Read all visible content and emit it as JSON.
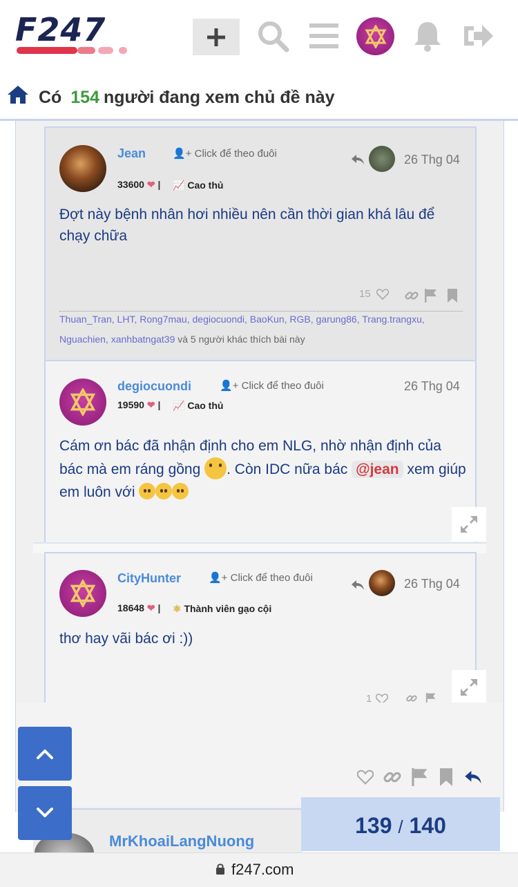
{
  "header": {
    "logo": "F247",
    "icons": [
      "plus-icon",
      "search-icon",
      "menu-icon",
      "user-avatar",
      "bell-icon",
      "logout-icon"
    ]
  },
  "viewers": {
    "prefix": "Có",
    "count": "154",
    "suffix": "người đang xem chủ đề này"
  },
  "posts": [
    {
      "username": "Jean",
      "follow": "Click để theo đuôi",
      "date": "26 Thg 04",
      "points": "33600",
      "rank": "Cao thủ",
      "body": "Đợt này bệnh nhân hơi nhiều nên cần thời gian khá lâu để chạy chữa",
      "likes": "15",
      "likers": [
        "Thuan_Tran",
        "LHT",
        "Rong7mau",
        "degiocuondi",
        "BaoKun",
        "RGB",
        "garung86",
        "Trang.trangxu",
        "Nguachien",
        "xanhbatngat39"
      ],
      "likers_suffix": "và 5 người khác thích bài này"
    },
    {
      "username": "degiocuondi",
      "follow": "Click để theo đuôi",
      "date": "26 Thg 04",
      "points": "19590",
      "rank": "Cao thủ",
      "body_1": "Cám ơn bác đã nhận định cho em NLG, nhờ nhận định của bác mà em ráng gồng",
      "body_2": ". Còn IDC nữa bác",
      "mention": "@jean",
      "body_3": "xem giúp em luôn với"
    },
    {
      "username": "CityHunter",
      "follow": "Click để theo đuôi",
      "date": "26 Thg 04",
      "points": "18648",
      "rank": "Thành viên gạo cội",
      "body": "thơ hay vãi bác ơi :))",
      "likes": "1"
    }
  ],
  "next_post": {
    "username": "MrKhoaiLangNuong"
  },
  "progress": {
    "current": "139",
    "separator": "/",
    "total": "140"
  },
  "url": "f247.com",
  "colors": {
    "brand_navy": "#1c2452",
    "accent_red": "#e0344a",
    "username_blue": "#4a8ad9",
    "body_blue": "#1a3a82",
    "count_green": "#3c9a3c",
    "nav_blue": "#3c6dc8"
  }
}
